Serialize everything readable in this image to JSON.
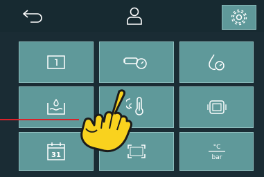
{
  "topbar": {
    "back_icon": "back-arrow-icon",
    "user_icon": "user-icon",
    "settings_icon": "gear-icon"
  },
  "tiles": [
    {
      "icon": "panel-info-icon"
    },
    {
      "icon": "pump-gauge-icon"
    },
    {
      "icon": "water-drop-gauge-icon"
    },
    {
      "icon": "tank-level-icon"
    },
    {
      "icon": "thermometer-icon"
    },
    {
      "icon": "display-screen-icon"
    },
    {
      "icon": "calendar-icon",
      "label": "31"
    },
    {
      "icon": "fullscreen-icon"
    },
    {
      "icon": "units-icon",
      "label_top": "°C",
      "label_bottom": "bar"
    }
  ],
  "overlay": {
    "pointer_icon": "pointing-hand-icon",
    "line_color": "#d9222a",
    "hand_color": "#f9d21e"
  },
  "colors": {
    "background": "#1a2c34",
    "tile": "#5f999a",
    "tile_border": "#8dbdbd"
  }
}
